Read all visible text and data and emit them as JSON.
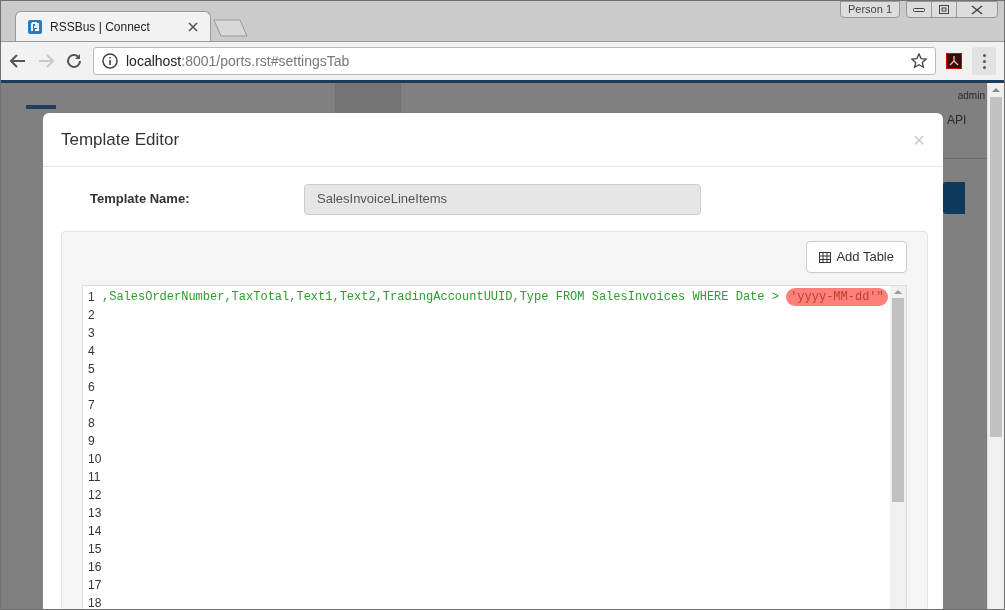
{
  "browser": {
    "tab_title": "RSSBus | Connect",
    "profile": "Person 1",
    "url_host": "localhost",
    "url_rest": ":8001/ports.rst#settingsTab"
  },
  "background_page": {
    "user_menu": "admin",
    "nav_link": "API"
  },
  "modal": {
    "title": "Template Editor",
    "close": "×",
    "template_name_label": "Template Name:",
    "template_name_value": "SalesInvoiceLineItems",
    "add_table_button": "Add Table",
    "editor": {
      "lines": [
        {
          "number": "1",
          "segments": [
            {
              "text": ",SalesOrderNumber,TaxTotal,Text1,Text2,TradingAccountUUID,Type FROM SalesInvoices WHERE Date > ",
              "highlighted": false
            },
            {
              "text": "'yyyy-MM-dd'\"",
              "highlighted": true
            }
          ]
        },
        {
          "number": "2"
        },
        {
          "number": "3"
        },
        {
          "number": "4"
        },
        {
          "number": "5"
        },
        {
          "number": "6"
        },
        {
          "number": "7"
        },
        {
          "number": "8"
        },
        {
          "number": "9"
        },
        {
          "number": "10"
        },
        {
          "number": "11"
        },
        {
          "number": "12"
        },
        {
          "number": "13"
        },
        {
          "number": "14"
        },
        {
          "number": "15"
        },
        {
          "number": "16"
        },
        {
          "number": "17"
        },
        {
          "number": "18"
        }
      ]
    }
  }
}
